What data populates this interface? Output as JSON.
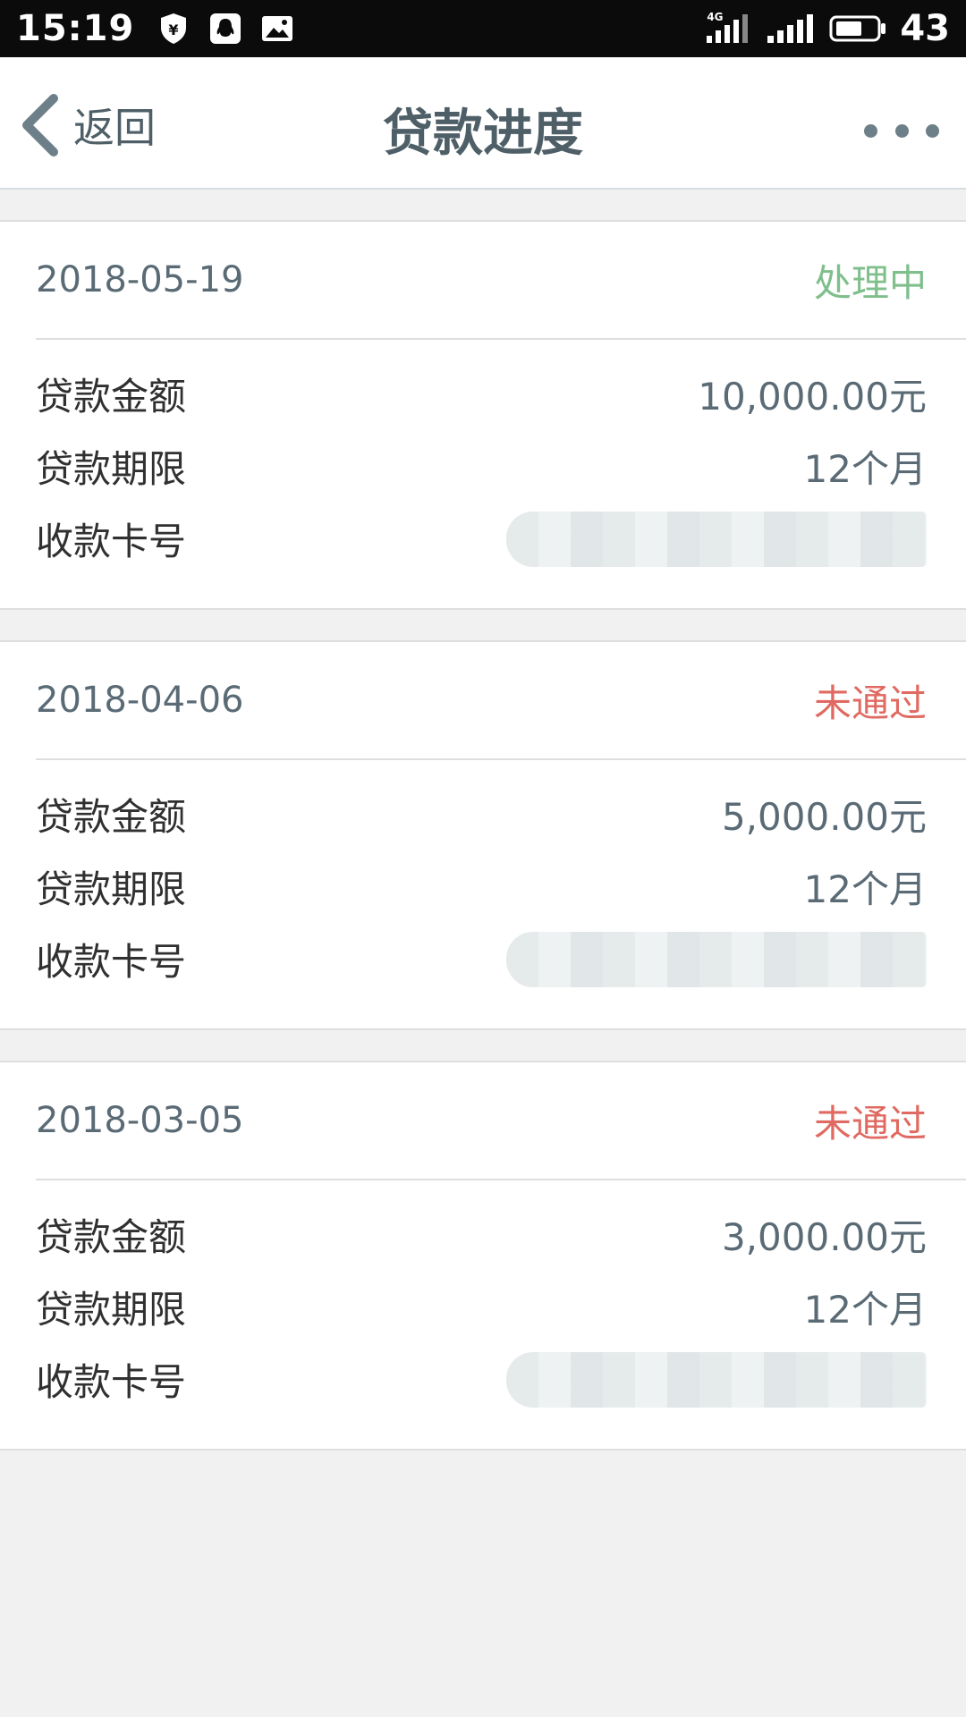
{
  "status_bar": {
    "time": "15:19",
    "network_type": "4G",
    "battery": "43",
    "icons": [
      "shield-yuan-icon",
      "qq-penguin-icon",
      "image-icon",
      "signal-4g-icon",
      "signal-icon",
      "battery-icon"
    ]
  },
  "header": {
    "back_label": "返回",
    "title": "贷款进度",
    "more_icon": "more-dots-icon"
  },
  "colors": {
    "status_processing": "#7fbf8c",
    "status_rejected": "#e06a62",
    "text_primary": "#303030",
    "text_secondary": "#5a6b76"
  },
  "loans": [
    {
      "date": "2018-05-19",
      "status": "处理中",
      "status_color": "#7fbf8c",
      "amount_label": "贷款金额",
      "amount": "10,000.00元",
      "term_label": "贷款期限",
      "term": "12个月",
      "card_label": "收款卡号"
    },
    {
      "date": "2018-04-06",
      "status": "未通过",
      "status_color": "#e06a62",
      "amount_label": "贷款金额",
      "amount": "5,000.00元",
      "term_label": "贷款期限",
      "term": "12个月",
      "card_label": "收款卡号"
    },
    {
      "date": "2018-03-05",
      "status": "未通过",
      "status_color": "#e06a62",
      "amount_label": "贷款金额",
      "amount": "3,000.00元",
      "term_label": "贷款期限",
      "term": "12个月",
      "card_label": "收款卡号"
    }
  ]
}
